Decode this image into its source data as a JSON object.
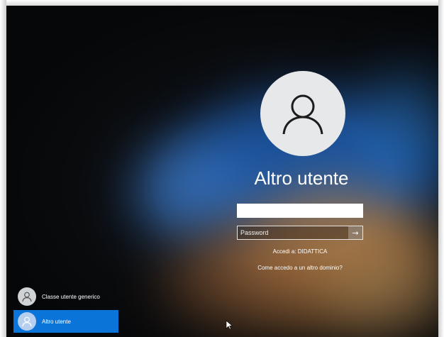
{
  "login": {
    "user_name": "Altro utente",
    "username_value": "",
    "password_placeholder": "Password",
    "submit_icon": "arrow-right-icon",
    "domain_label": "Accedi a: DIDATTICA",
    "other_domain_link": "Come accedo a un altro dominio?"
  },
  "user_list": [
    {
      "label": "Classe utente generico",
      "selected": false
    },
    {
      "label": "Altro utente",
      "selected": true
    }
  ],
  "colors": {
    "accent": "#0a74d9",
    "avatar_bg": "#e6e8ea",
    "text": "#ffffff"
  }
}
